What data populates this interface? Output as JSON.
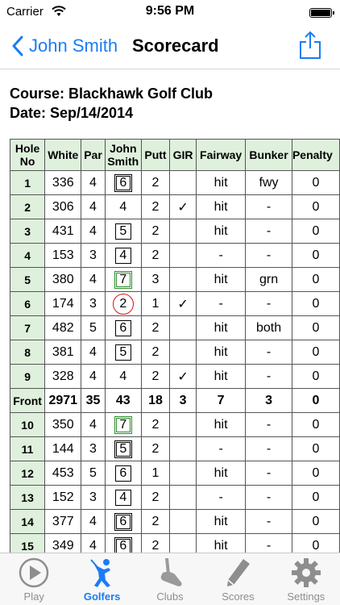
{
  "status_bar": {
    "carrier": "Carrier",
    "time": "9:56 PM"
  },
  "nav": {
    "back_label": "John Smith",
    "title": "Scorecard"
  },
  "info": {
    "course": "Course: Blackhawk Golf Club",
    "date": "Date: Sep/14/2014"
  },
  "table": {
    "headers": [
      "Hole No",
      "White",
      "Par",
      "John Smith",
      "Putt",
      "GIR",
      "Fairway",
      "Bunker",
      "Penalty"
    ],
    "rows": [
      [
        "1",
        "336",
        "4",
        "6",
        "2",
        "",
        "hit",
        "fwy",
        "0"
      ],
      [
        "2",
        "306",
        "4",
        "4",
        "2",
        "✓",
        "hit",
        "-",
        "0"
      ],
      [
        "3",
        "431",
        "4",
        "5",
        "2",
        "",
        "hit",
        "-",
        "0"
      ],
      [
        "4",
        "153",
        "3",
        "4",
        "2",
        "",
        "-",
        "-",
        "0"
      ],
      [
        "5",
        "380",
        "4",
        "7",
        "3",
        "",
        "hit",
        "grn",
        "0"
      ],
      [
        "6",
        "174",
        "3",
        "2",
        "1",
        "✓",
        "-",
        "-",
        "0"
      ],
      [
        "7",
        "482",
        "5",
        "6",
        "2",
        "",
        "hit",
        "both",
        "0"
      ],
      [
        "8",
        "381",
        "4",
        "5",
        "2",
        "",
        "hit",
        "-",
        "0"
      ],
      [
        "9",
        "328",
        "4",
        "4",
        "2",
        "✓",
        "hit",
        "-",
        "0"
      ],
      [
        "Front",
        "2971",
        "35",
        "43",
        "18",
        "3",
        "7",
        "3",
        "0"
      ],
      [
        "10",
        "350",
        "4",
        "7",
        "2",
        "",
        "hit",
        "-",
        "0"
      ],
      [
        "11",
        "144",
        "3",
        "5",
        "2",
        "",
        "-",
        "-",
        "0"
      ],
      [
        "12",
        "453",
        "5",
        "6",
        "1",
        "",
        "hit",
        "-",
        "0"
      ],
      [
        "13",
        "152",
        "3",
        "4",
        "2",
        "",
        "-",
        "-",
        "0"
      ],
      [
        "14",
        "377",
        "4",
        "6",
        "2",
        "",
        "hit",
        "-",
        "0"
      ],
      [
        "15",
        "349",
        "4",
        "6",
        "2",
        "",
        "hit",
        "-",
        "0"
      ]
    ]
  },
  "tabbar": {
    "tabs": [
      {
        "label": "Play",
        "icon": "play-icon"
      },
      {
        "label": "Golfers",
        "icon": "golfer-icon"
      },
      {
        "label": "Clubs",
        "icon": "club-icon"
      },
      {
        "label": "Scores",
        "icon": "pencil-icon"
      },
      {
        "label": "Settings",
        "icon": "gear-icon"
      }
    ],
    "active_color": "#1a7cf5"
  }
}
